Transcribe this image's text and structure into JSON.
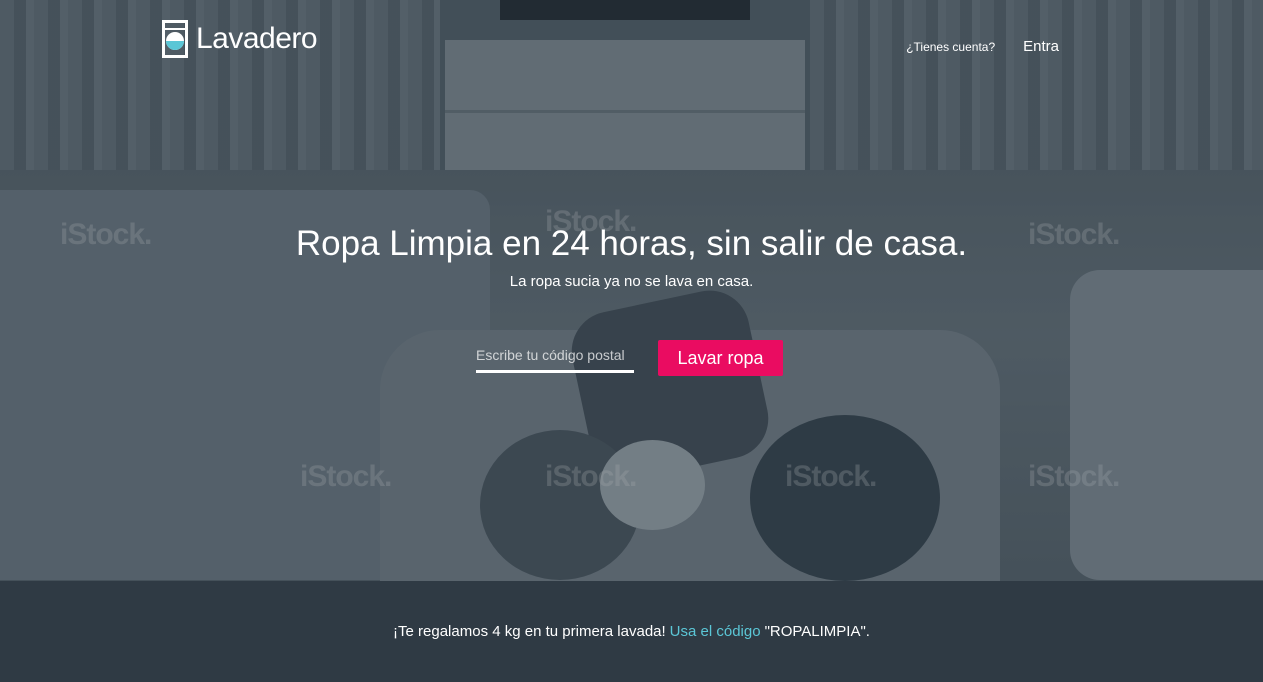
{
  "brand": {
    "name": "Lavadero",
    "icon": "washing-machine-icon"
  },
  "nav": {
    "account_prompt": "¿Tienes cuenta?",
    "login_label": "Entra"
  },
  "hero": {
    "headline": "Ropa Limpia en 24 horas, sin salir de casa.",
    "subheadline": "La ropa sucia ya no se lava en casa.",
    "zip_placeholder": "Escribe tu código postal",
    "zip_value": "",
    "cta_label": "Lavar ropa",
    "watermark": "iStock."
  },
  "promo": {
    "text_before": "¡Te regalamos 4 kg en tu primera lavada!",
    "link_label": "Usa el código",
    "code_text": "\"ROPALIMPIA\"."
  },
  "colors": {
    "accent": "#ea0c61",
    "link": "#5bc6d6",
    "footer_bg": "#2f3a44"
  }
}
